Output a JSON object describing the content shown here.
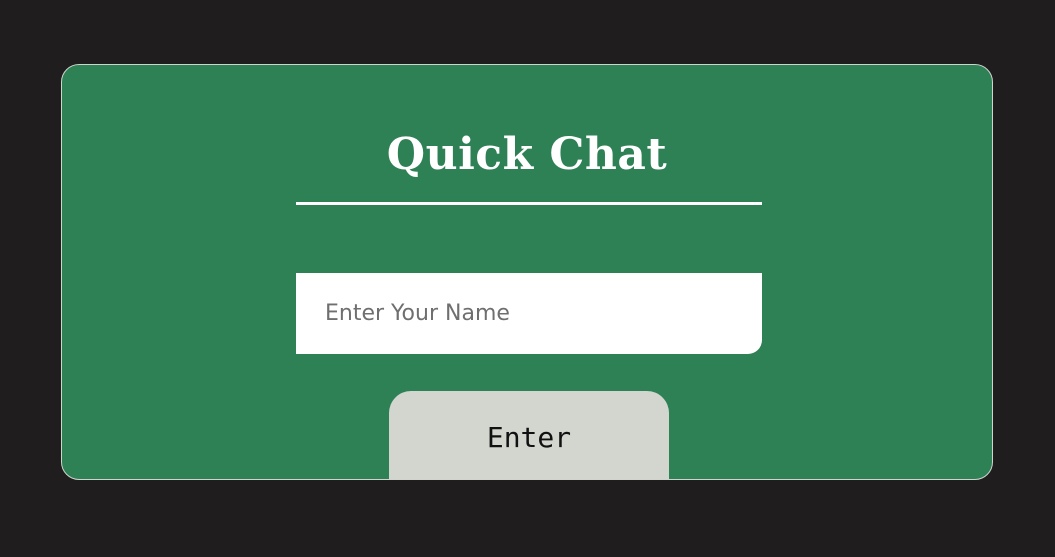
{
  "app": {
    "title": "Quick Chat"
  },
  "login_form": {
    "name_placeholder": "Enter Your Name",
    "name_value": "",
    "submit_label": "Enter"
  },
  "colors": {
    "background": "#1f1d1e",
    "card": "#2e8055",
    "card_border": "#cfd4cc",
    "button": "#d2d6cf",
    "input": "#ffffff"
  }
}
